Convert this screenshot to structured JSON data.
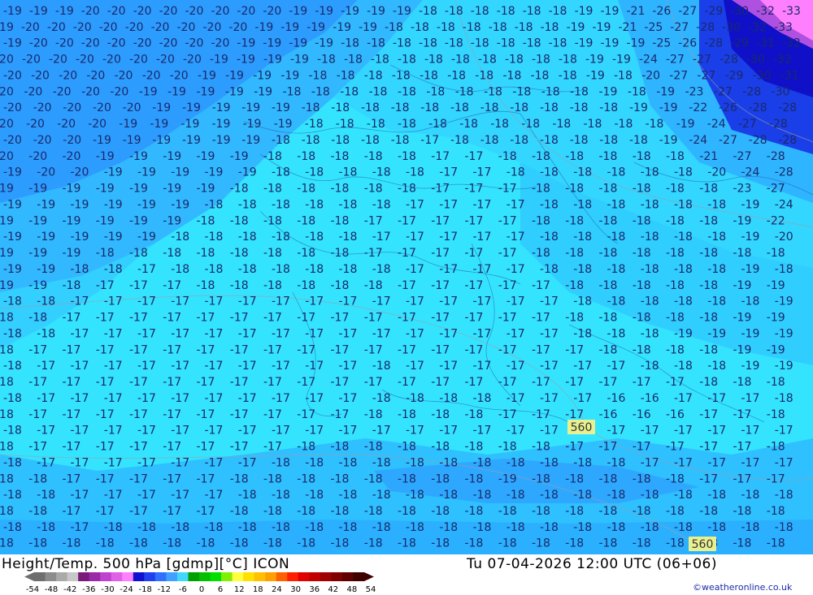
{
  "map": {
    "contour_label_a": "560",
    "contour_label_b": "560"
  },
  "footer": {
    "title": "Height/Temp. 500 hPa [gdmp][°C] ICON",
    "datetime": "Tu 07-04-2026 12:00 UTC (06+06)",
    "credit": "©weatheronline.co.uk"
  },
  "legend": {
    "ticks": [
      "-54",
      "-48",
      "-42",
      "-36",
      "-30",
      "-24",
      "-18",
      "-12",
      "-6",
      "0",
      "6",
      "12",
      "18",
      "24",
      "30",
      "36",
      "42",
      "48",
      "54"
    ],
    "colors": [
      "#6e6e6e",
      "#8c8c8c",
      "#aaaaaa",
      "#c8c8c8",
      "#7a1a7a",
      "#9a2aa8",
      "#c040d0",
      "#e060e8",
      "#ff80ff",
      "#1010d0",
      "#2040f0",
      "#3070ff",
      "#40a0ff",
      "#40d8ff",
      "#00a000",
      "#00c000",
      "#00e000",
      "#80f000",
      "#ffff40",
      "#ffe000",
      "#ffc000",
      "#ffa000",
      "#ff6000",
      "#ff2000",
      "#e00000",
      "#c00000",
      "#a00000",
      "#800000",
      "#600000",
      "#400000"
    ]
  },
  "temperature_labels": [
    {
      "row": 0,
      "values": [
        "19",
        "19",
        "19",
        "20",
        "20",
        "20",
        "20",
        "20",
        "20",
        "20",
        "20",
        "19",
        "19",
        "19",
        "19",
        "19",
        "18",
        "18",
        "18",
        "18",
        "18",
        "18",
        "19",
        "19",
        "21",
        "26",
        "27",
        "29",
        "30",
        "32",
        "33"
      ]
    },
    {
      "row": 1,
      "values": [
        "19",
        "20",
        "20",
        "20",
        "20",
        "20",
        "20",
        "20",
        "20",
        "20",
        "19",
        "19",
        "19",
        "19",
        "19",
        "18",
        "18",
        "18",
        "18",
        "18",
        "18",
        "18",
        "19",
        "19",
        "21",
        "25",
        "27",
        "28",
        "30",
        "32",
        "33"
      ]
    },
    {
      "row": 2,
      "values": [
        "19",
        "20",
        "20",
        "20",
        "20",
        "20",
        "20",
        "20",
        "20",
        "19",
        "19",
        "19",
        "19",
        "18",
        "18",
        "18",
        "18",
        "18",
        "18",
        "18",
        "18",
        "18",
        "19",
        "19",
        "19",
        "25",
        "26",
        "28",
        "29",
        "31",
        "32"
      ]
    },
    {
      "row": 3,
      "values": [
        "20",
        "20",
        "20",
        "20",
        "20",
        "20",
        "20",
        "20",
        "19",
        "19",
        "19",
        "19",
        "18",
        "18",
        "18",
        "18",
        "18",
        "18",
        "18",
        "18",
        "18",
        "18",
        "19",
        "19",
        "24",
        "27",
        "27",
        "28",
        "30",
        "32"
      ]
    },
    {
      "row": 4,
      "values": [
        "20",
        "20",
        "20",
        "20",
        "20",
        "20",
        "20",
        "19",
        "19",
        "19",
        "19",
        "18",
        "18",
        "18",
        "18",
        "18",
        "18",
        "18",
        "18",
        "18",
        "18",
        "19",
        "18",
        "20",
        "27",
        "27",
        "29",
        "30",
        "31"
      ]
    },
    {
      "row": 5,
      "values": [
        "20",
        "20",
        "20",
        "20",
        "20",
        "19",
        "19",
        "19",
        "19",
        "19",
        "18",
        "18",
        "18",
        "18",
        "18",
        "18",
        "18",
        "18",
        "18",
        "18",
        "18",
        "19",
        "18",
        "19",
        "23",
        "27",
        "28",
        "30"
      ]
    },
    {
      "row": 6,
      "values": [
        "20",
        "20",
        "20",
        "20",
        "20",
        "19",
        "19",
        "19",
        "19",
        "19",
        "18",
        "18",
        "18",
        "18",
        "18",
        "18",
        "18",
        "18",
        "18",
        "18",
        "18",
        "19",
        "19",
        "22",
        "26",
        "28",
        "28"
      ]
    },
    {
      "row": 7,
      "values": [
        "20",
        "20",
        "20",
        "20",
        "19",
        "19",
        "19",
        "19",
        "19",
        "19",
        "18",
        "18",
        "18",
        "18",
        "18",
        "18",
        "18",
        "18",
        "18",
        "18",
        "18",
        "18",
        "19",
        "24",
        "27",
        "28"
      ]
    },
    {
      "row": 8,
      "values": [
        "20",
        "20",
        "20",
        "19",
        "19",
        "19",
        "19",
        "19",
        "19",
        "18",
        "18",
        "18",
        "18",
        "18",
        "17",
        "18",
        "18",
        "18",
        "18",
        "18",
        "18",
        "18",
        "19",
        "24",
        "27",
        "28",
        "28"
      ]
    },
    {
      "row": 9,
      "values": [
        "20",
        "20",
        "20",
        "19",
        "19",
        "19",
        "19",
        "19",
        "18",
        "18",
        "18",
        "18",
        "18",
        "17",
        "17",
        "18",
        "18",
        "18",
        "18",
        "18",
        "18",
        "21",
        "27",
        "28"
      ]
    },
    {
      "row": 10,
      "values": [
        "19",
        "20",
        "20",
        "19",
        "19",
        "19",
        "19",
        "19",
        "18",
        "18",
        "18",
        "18",
        "18",
        "17",
        "17",
        "18",
        "18",
        "18",
        "18",
        "18",
        "18",
        "20",
        "24",
        "28"
      ]
    },
    {
      "row": 11,
      "values": [
        "19",
        "19",
        "19",
        "19",
        "19",
        "19",
        "19",
        "18",
        "18",
        "18",
        "18",
        "18",
        "18",
        "17",
        "17",
        "17",
        "18",
        "18",
        "18",
        "18",
        "18",
        "18",
        "23",
        "27"
      ]
    },
    {
      "row": 12,
      "values": [
        "19",
        "19",
        "19",
        "19",
        "19",
        "19",
        "18",
        "18",
        "18",
        "18",
        "18",
        "18",
        "17",
        "17",
        "17",
        "17",
        "18",
        "18",
        "18",
        "18",
        "18",
        "18",
        "19",
        "24"
      ]
    },
    {
      "row": 13,
      "values": [
        "19",
        "19",
        "19",
        "19",
        "19",
        "19",
        "18",
        "18",
        "18",
        "18",
        "18",
        "17",
        "17",
        "17",
        "17",
        "17",
        "18",
        "18",
        "18",
        "18",
        "18",
        "18",
        "19",
        "22"
      ]
    },
    {
      "row": 14,
      "values": [
        "19",
        "19",
        "19",
        "19",
        "19",
        "18",
        "18",
        "18",
        "18",
        "18",
        "18",
        "17",
        "17",
        "17",
        "17",
        "17",
        "18",
        "18",
        "18",
        "18",
        "18",
        "18",
        "19",
        "20"
      ]
    },
    {
      "row": 15,
      "values": [
        "19",
        "19",
        "19",
        "18",
        "18",
        "18",
        "18",
        "18",
        "18",
        "18",
        "18",
        "17",
        "17",
        "17",
        "17",
        "17",
        "18",
        "18",
        "18",
        "18",
        "18",
        "18",
        "18",
        "18"
      ]
    },
    {
      "row": 16,
      "values": [
        "19",
        "19",
        "18",
        "18",
        "17",
        "18",
        "18",
        "18",
        "18",
        "18",
        "18",
        "18",
        "17",
        "17",
        "17",
        "17",
        "18",
        "18",
        "18",
        "18",
        "18",
        "18",
        "19",
        "18"
      ]
    },
    {
      "row": 17,
      "values": [
        "19",
        "19",
        "18",
        "17",
        "17",
        "17",
        "18",
        "18",
        "18",
        "18",
        "18",
        "18",
        "17",
        "17",
        "17",
        "17",
        "17",
        "18",
        "18",
        "18",
        "18",
        "18",
        "19",
        "19"
      ]
    },
    {
      "row": 18,
      "values": [
        "18",
        "18",
        "17",
        "17",
        "17",
        "17",
        "17",
        "17",
        "17",
        "17",
        "17",
        "17",
        "17",
        "17",
        "17",
        "17",
        "17",
        "18",
        "18",
        "18",
        "18",
        "18",
        "18",
        "19"
      ]
    },
    {
      "row": 19,
      "values": [
        "18",
        "18",
        "17",
        "17",
        "17",
        "17",
        "17",
        "17",
        "17",
        "17",
        "17",
        "17",
        "17",
        "17",
        "17",
        "17",
        "17",
        "18",
        "18",
        "18",
        "18",
        "18",
        "19",
        "19"
      ]
    },
    {
      "row": 20,
      "values": [
        "18",
        "18",
        "17",
        "17",
        "17",
        "17",
        "17",
        "17",
        "17",
        "17",
        "17",
        "17",
        "17",
        "17",
        "17",
        "17",
        "17",
        "18",
        "18",
        "18",
        "19",
        "19",
        "19",
        "19"
      ]
    },
    {
      "row": 21,
      "values": [
        "18",
        "17",
        "17",
        "17",
        "17",
        "17",
        "17",
        "17",
        "17",
        "17",
        "17",
        "17",
        "17",
        "17",
        "17",
        "17",
        "17",
        "17",
        "18",
        "18",
        "18",
        "18",
        "19",
        "19"
      ]
    },
    {
      "row": 22,
      "values": [
        "18",
        "17",
        "17",
        "17",
        "17",
        "17",
        "17",
        "17",
        "17",
        "17",
        "17",
        "18",
        "17",
        "17",
        "17",
        "17",
        "17",
        "17",
        "17",
        "18",
        "18",
        "18",
        "19",
        "19"
      ]
    },
    {
      "row": 23,
      "values": [
        "18",
        "17",
        "17",
        "17",
        "17",
        "17",
        "17",
        "17",
        "17",
        "17",
        "17",
        "17",
        "17",
        "17",
        "17",
        "17",
        "17",
        "17",
        "17",
        "17",
        "17",
        "18",
        "18",
        "18"
      ]
    },
    {
      "row": 24,
      "values": [
        "18",
        "17",
        "17",
        "17",
        "17",
        "17",
        "17",
        "17",
        "17",
        "17",
        "17",
        "18",
        "18",
        "18",
        "18",
        "17",
        "17",
        "17",
        "16",
        "16",
        "17",
        "17",
        "17",
        "18"
      ]
    },
    {
      "row": 25,
      "values": [
        "18",
        "17",
        "17",
        "17",
        "17",
        "17",
        "17",
        "17",
        "17",
        "17",
        "17",
        "18",
        "18",
        "18",
        "18",
        "17",
        "17",
        "17",
        "16",
        "16",
        "16",
        "17",
        "17",
        "18"
      ]
    },
    {
      "row": 26,
      "values": [
        "18",
        "17",
        "17",
        "17",
        "17",
        "17",
        "17",
        "17",
        "17",
        "17",
        "17",
        "17",
        "17",
        "17",
        "17",
        "17",
        "17",
        "17",
        "17",
        "17",
        "17",
        "17",
        "17",
        "17"
      ]
    },
    {
      "row": 27,
      "values": [
        "18",
        "17",
        "17",
        "17",
        "17",
        "17",
        "17",
        "17",
        "17",
        "18",
        "18",
        "18",
        "18",
        "18",
        "18",
        "18",
        "18",
        "17",
        "17",
        "17",
        "17",
        "17",
        "17",
        "18"
      ]
    },
    {
      "row": 28,
      "values": [
        "18",
        "17",
        "17",
        "17",
        "17",
        "17",
        "17",
        "17",
        "18",
        "18",
        "18",
        "18",
        "18",
        "18",
        "18",
        "18",
        "18",
        "18",
        "18",
        "17",
        "17",
        "17",
        "17",
        "17"
      ]
    },
    {
      "row": 29,
      "values": [
        "18",
        "18",
        "17",
        "17",
        "17",
        "17",
        "17",
        "18",
        "18",
        "18",
        "18",
        "18",
        "18",
        "18",
        "18",
        "19",
        "18",
        "18",
        "18",
        "18",
        "18",
        "17",
        "17",
        "17"
      ]
    },
    {
      "row": 30,
      "values": [
        "18",
        "18",
        "17",
        "17",
        "17",
        "17",
        "17",
        "18",
        "18",
        "18",
        "18",
        "18",
        "18",
        "18",
        "18",
        "18",
        "18",
        "18",
        "18",
        "18",
        "18",
        "18",
        "18",
        "18"
      ]
    },
    {
      "row": 31,
      "values": [
        "18",
        "18",
        "17",
        "17",
        "17",
        "17",
        "17",
        "18",
        "18",
        "18",
        "18",
        "18",
        "18",
        "18",
        "18",
        "18",
        "18",
        "18",
        "18",
        "18",
        "18",
        "18",
        "18",
        "18"
      ]
    },
    {
      "row": 32,
      "values": [
        "18",
        "18",
        "17",
        "18",
        "18",
        "18",
        "18",
        "18",
        "18",
        "18",
        "18",
        "18",
        "18",
        "18",
        "18",
        "18",
        "18",
        "18",
        "18",
        "18",
        "18",
        "18",
        "18",
        "18"
      ]
    },
    {
      "row": 33,
      "values": [
        "18",
        "18",
        "18",
        "18",
        "18",
        "18",
        "18",
        "18",
        "18",
        "18",
        "18",
        "18",
        "18",
        "18",
        "18",
        "18",
        "18",
        "18",
        "18",
        "18",
        "18",
        "18",
        "18",
        "18"
      ]
    }
  ]
}
